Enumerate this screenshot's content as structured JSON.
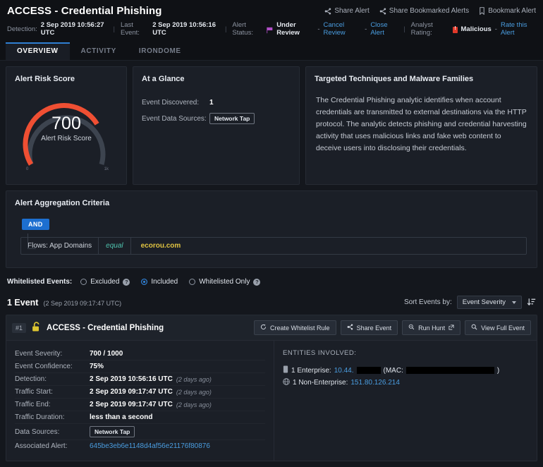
{
  "header": {
    "title": "ACCESS - Credential Phishing",
    "actions": [
      {
        "label": "Share Alert",
        "icon": "share-icon"
      },
      {
        "label": "Share Bookmarked Alerts",
        "icon": "share-icon"
      },
      {
        "label": "Bookmark Alert",
        "icon": "bookmark-icon"
      }
    ],
    "meta": {
      "detection_label": "Detection:",
      "detection_value": "2 Sep 2019 10:56:27 UTC",
      "last_event_label": "Last Event:",
      "last_event_value": "2 Sep 2019 10:56:16 UTC",
      "alert_status_label": "Alert Status:",
      "alert_status_value": "Under Review",
      "cancel_review": "Cancel Review",
      "close_alert": "Close Alert",
      "analyst_rating_label": "Analyst Rating:",
      "analyst_rating_value": "Malicious",
      "rate_this_alert": "Rate this Alert",
      "separator": "-"
    }
  },
  "tabs": [
    {
      "label": "OVERVIEW",
      "active": true
    },
    {
      "label": "ACTIVITY",
      "active": false
    },
    {
      "label": "IRONDOME",
      "active": false
    }
  ],
  "risk": {
    "panel_title": "Alert Risk Score",
    "score": "700",
    "caption": "Alert Risk Score",
    "min_label": "0",
    "max_label": "1k",
    "arc_color": "#ef4f33",
    "track_color": "#3d444f"
  },
  "glance": {
    "panel_title": "At a Glance",
    "rows": [
      {
        "label": "Event Discovered:",
        "value": "1",
        "chip": false
      },
      {
        "label": "Event Data Sources:",
        "value": "Network Tap",
        "chip": true
      }
    ]
  },
  "techniques": {
    "panel_title": "Targeted Techniques and Malware Families",
    "body": "The Credential Phishing analytic identifies when account credentials are transmitted to external destinations via the HTTP protocol. The analytic detects phishing and credential harvesting activity that uses malicious links and fake web content to deceive users into disclosing their credentials."
  },
  "aggregation": {
    "panel_title": "Alert Aggregation Criteria",
    "operator": "AND",
    "criteria": [
      {
        "field": "Flows: App Domains",
        "op": "equal",
        "value": "ecorou.com"
      }
    ]
  },
  "whitelist": {
    "label": "Whitelisted Events:",
    "options": [
      {
        "label": "Excluded",
        "selected": false,
        "help": true
      },
      {
        "label": "Included",
        "selected": true,
        "help": false
      },
      {
        "label": "Whitelisted Only",
        "selected": false,
        "help": true
      }
    ],
    "help_glyph": "?"
  },
  "events_header": {
    "count": "1 Event",
    "timestamp": "(2 Sep 2019 09:17:47 UTC)",
    "sort_label": "Sort Events by:",
    "sort_value": "Event Severity",
    "sort_direction_icon": "sort-descending-icon"
  },
  "event": {
    "index": "#1",
    "lock_icon": "unlocked-padlock-icon",
    "name": "ACCESS - Credential Phishing",
    "buttons": [
      {
        "label": "Create Whitelist Rule",
        "icon": "refresh-icon"
      },
      {
        "label": "Share Event",
        "icon": "share-icon"
      },
      {
        "label": "Run Hunt",
        "icon": "hunt-icon",
        "external": true
      },
      {
        "label": "View Full Event",
        "icon": "search-icon"
      }
    ],
    "details": [
      {
        "label": "Event Severity:",
        "value": "700 / 1000"
      },
      {
        "label": "Event Confidence:",
        "value": "75%"
      },
      {
        "label": "Detection:",
        "value": "2 Sep 2019 10:56:16 UTC",
        "ago": "(2 days ago)"
      },
      {
        "label": "Traffic Start:",
        "value": "2 Sep 2019 09:17:47 UTC",
        "ago": "(2 days ago)"
      },
      {
        "label": "Traffic End:",
        "value": "2 Sep 2019 09:17:47 UTC",
        "ago": "(2 days ago)"
      },
      {
        "label": "Traffic Duration:",
        "value": "less than a second"
      },
      {
        "label": "Data Sources:",
        "value": "Network Tap",
        "chip": true
      },
      {
        "label": "Associated Alert:",
        "value": "645be3eb6e1148d4af56e21176f80876",
        "link": true
      }
    ],
    "entities": {
      "title": "ENTITIES INVOLVED:",
      "enterprise_prefix": "1 Enterprise:",
      "enterprise_ip": "10.44.",
      "enterprise_mac_label": "(MAC: ",
      "enterprise_mac_close": ")",
      "nonenterprise_prefix": "1 Non-Enterprise:",
      "nonenterprise_ip": "151.80.126.214"
    }
  }
}
